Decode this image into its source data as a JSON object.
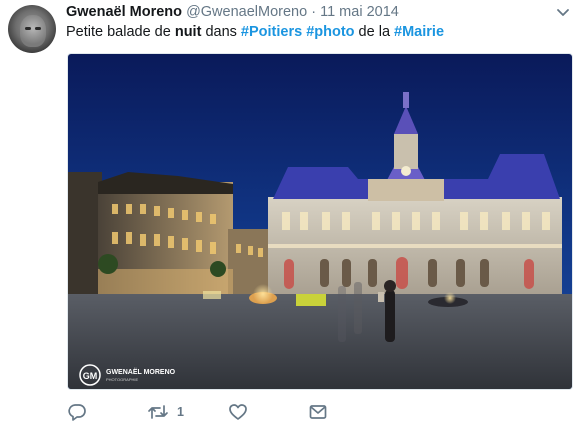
{
  "author": {
    "display_name": "Gwenaël Moreno",
    "handle": "@GwenaelMoreno",
    "separator": "·",
    "date": "11 mai 2014"
  },
  "tweet": {
    "t1": "Petite balade de ",
    "t2": "nuit",
    "t3": " dans ",
    "tag1": "#Poitiers",
    "t4": " ",
    "tag2": "#photo",
    "t5": " de la ",
    "tag3": "#Mairie"
  },
  "photo": {
    "watermark_name": "GWENAËL MORENO",
    "watermark_sub": "PHOTOGRAPHIE",
    "watermark_initials": "GM"
  },
  "actions": {
    "retweet_count": "1"
  },
  "colors": {
    "hashtag": "#1b95e0",
    "muted": "#657786"
  },
  "icons": [
    "chevron-down-icon",
    "reply-icon",
    "retweet-icon",
    "like-icon",
    "message-icon"
  ]
}
